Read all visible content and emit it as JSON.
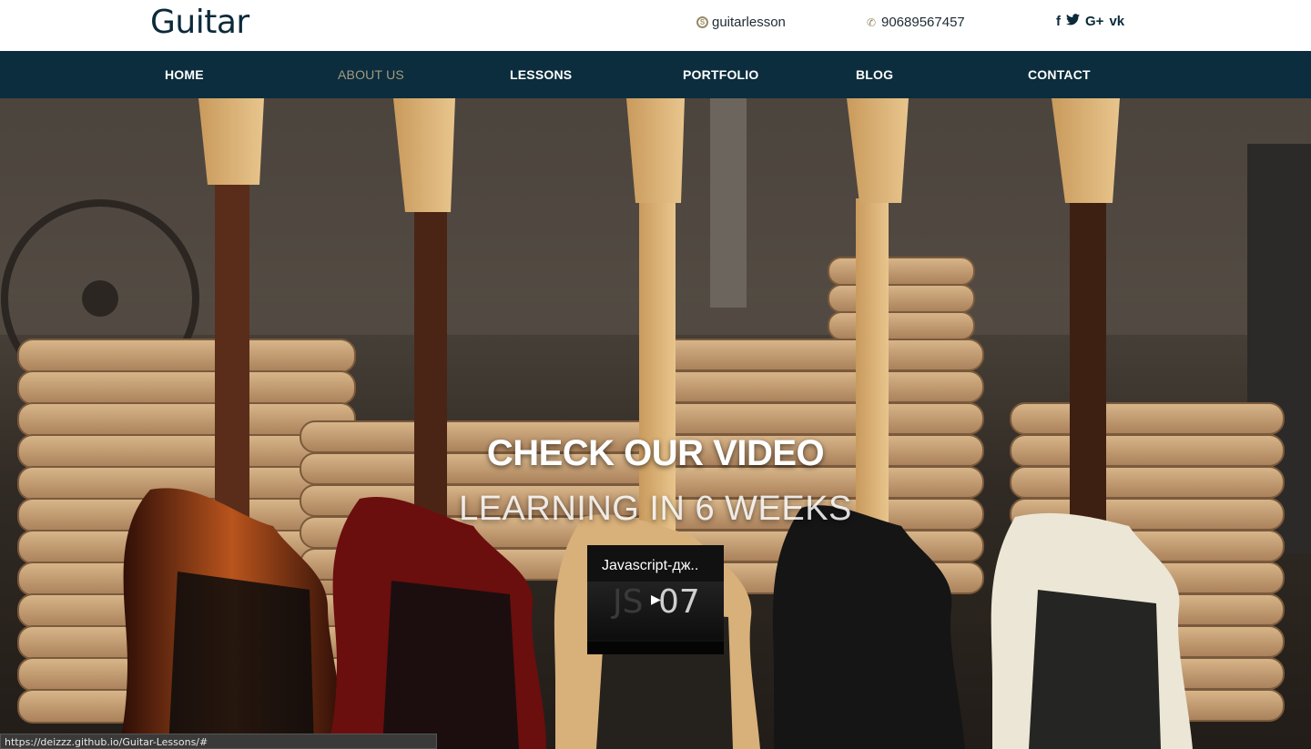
{
  "header": {
    "logo": "Guitar",
    "skype": "guitarlesson",
    "phone": "90689567457",
    "socials": [
      "f",
      "t",
      "G+",
      "vk"
    ]
  },
  "nav": {
    "items": [
      {
        "label": "HOME",
        "active": false
      },
      {
        "label": "ABOUT US",
        "active": true
      },
      {
        "label": "LESSONS",
        "active": false
      },
      {
        "label": "PORTFOLIO",
        "active": false
      },
      {
        "label": "BLOG",
        "active": false
      },
      {
        "label": "CONTACT",
        "active": false
      }
    ]
  },
  "hero": {
    "title": "CHECK OUR VIDEO",
    "subtitle": "LEARNING IN 6 WEEKS",
    "video": {
      "title": "Javascript-дж..",
      "thumb_left": "JS",
      "thumb_right": "07",
      "play_icon": "▶"
    }
  },
  "status": {
    "url": "https://deizzz.github.io/Guitar-Lessons/#"
  },
  "colors": {
    "nav_bg": "#0b2d3d",
    "logo": "#0b2a3a",
    "active_nav": "#a59b80"
  }
}
